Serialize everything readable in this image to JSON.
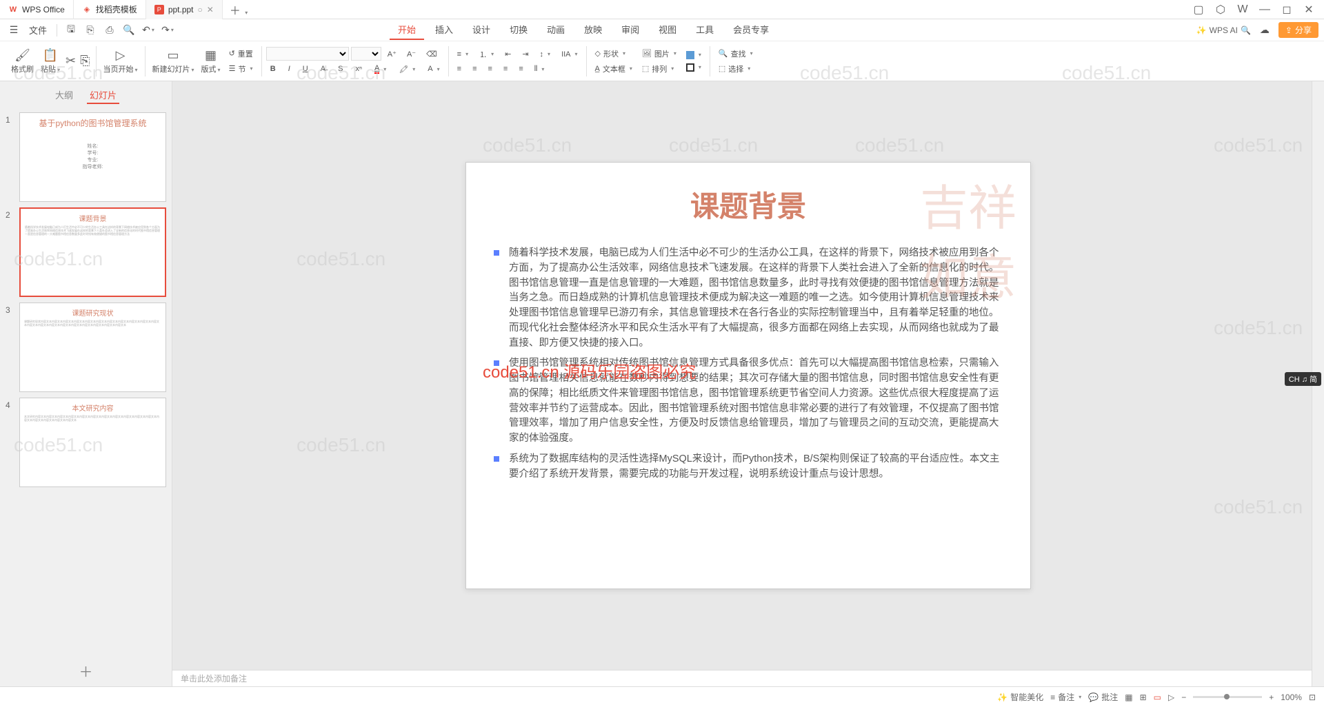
{
  "tabs": {
    "wps_office": "WPS Office",
    "template": "找稻壳模板",
    "ppt": "ppt.ppt"
  },
  "menu": {
    "file": "文件",
    "items": [
      "开始",
      "插入",
      "设计",
      "切换",
      "动画",
      "放映",
      "审阅",
      "视图",
      "工具",
      "会员专享"
    ],
    "wps_ai": "WPS AI",
    "share": "分享"
  },
  "ribbon": {
    "format_brush": "格式刷",
    "paste": "粘贴",
    "start_page": "当页开始",
    "new_slide": "新建幻灯片",
    "layout": "版式",
    "section": "节",
    "reset": "重置",
    "shape": "形状",
    "picture": "图片",
    "textbox": "文本框",
    "arrange": "排列",
    "find": "查找",
    "select": "选择"
  },
  "panel": {
    "outline": "大纲",
    "slides": "幻灯片"
  },
  "thumbnails": [
    {
      "num": "1",
      "title": "基于python的图书馆管理系统",
      "sub": [
        "姓名:",
        "学号:",
        "专业:",
        "指导老师:"
      ]
    },
    {
      "num": "2",
      "title": "课题背景"
    },
    {
      "num": "3",
      "title": "课题研究现状"
    },
    {
      "num": "4",
      "title": "本文研究内容"
    }
  ],
  "slide": {
    "heading": "课题背景",
    "para1": "随着科学技术发展，电脑已成为人们生活中必不可少的生活办公工具，在这样的背景下，网络技术被应用到各个方面，为了提高办公生活效率，网络信息技术飞速发展。在这样的背景下人类社会进入了全新的信息化的时代。图书馆信息管理一直是信息管理的一大难题，图书馆信息数量多，此时寻找有效便捷的图书馆信息管理方法就是当务之急。而日趋成熟的计算机信息管理技术便成为解决这一难题的唯一之选。如今使用计算机信息管理技术来处理图书馆信息管理早已游刃有余，其信息管理技术在各行各业的实际控制管理当中，且有着举足轻重的地位。而现代化社会整体经济水平和民众生活水平有了大幅提高，很多方面都在网络上去实现，从而网络也就成为了最直接、即方便又快捷的接入口。",
    "para2": "使用图书馆管理系统相对传统图书馆信息管理方式具备很多优点：首先可以大幅提高图书馆信息检索，只需输入图书馆管理相关信息就能在数秒内得到想要的结果；其次可存储大量的图书馆信息，同时图书馆信息安全性有更高的保障；相比纸质文件来管理图书馆信息，图书馆管理系统更节省空间人力资源。这些优点很大程度提高了运营效率并节约了运营成本。因此，图书馆管理系统对图书馆信息非常必要的进行了有效管理，不仅提高了图书馆管理效率，增加了用户信息安全性，方便及时反馈信息给管理员，增加了与管理员之间的互动交流，更能提高大家的体验强度。",
    "para3": "系统为了数据库结构的灵活性选择MySQL来设计，而Python技术，B/S架构则保证了较高的平台适应性。本文主要介绍了系统开发背景，需要完成的功能与开发过程，说明系统设计重点与设计思想。"
  },
  "notes": "单击此处添加备注",
  "status": {
    "smart_beautify": "智能美化",
    "notes": "备注",
    "comments": "批注",
    "zoom": "100%"
  },
  "watermark": "code51.cn",
  "watermark_red": "code51.cn 源码乐园盗图必究",
  "ime": "CH ♫ 简"
}
